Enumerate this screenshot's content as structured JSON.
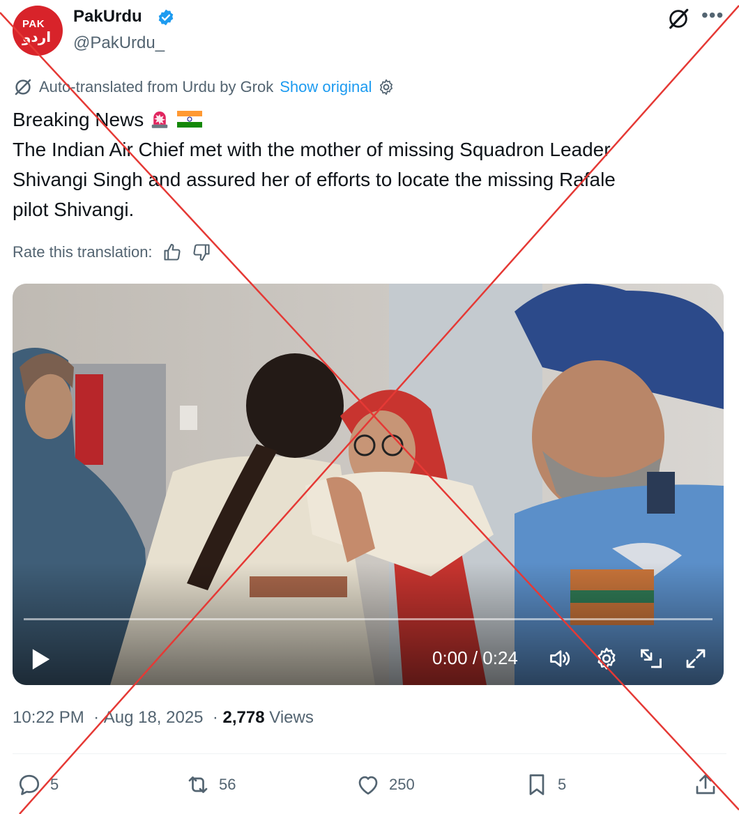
{
  "author": {
    "name": "PakUrdu",
    "handle": "@PakUrdu_",
    "avatar_text_top": "PAK",
    "avatar_text_bottom": "اردو",
    "avatar_color": "#d8232a",
    "verified": true,
    "verified_color": "#1d9bf0"
  },
  "icons": {
    "grok": "grok-icon",
    "more": "more-icon",
    "settings": "gear-icon",
    "thumbs_up": "thumbs-up-icon",
    "thumbs_down": "thumbs-down-icon"
  },
  "translation": {
    "label": "Auto-translated from Urdu by Grok",
    "show_original": "Show original"
  },
  "tweet": {
    "line1": "Breaking News",
    "line2": "The Indian Air Chief met with the mother of missing Squadron Leader",
    "line3": "Shivangi Singh and assured her of efforts to locate the missing Rafale",
    "line4": "pilot Shivangi.",
    "emojis": [
      "police-light",
      "india-flag"
    ]
  },
  "rate": {
    "label": "Rate this translation:"
  },
  "video": {
    "time": "0:00 / 0:24",
    "progress": 0.0
  },
  "meta": {
    "time": "10:22 PM",
    "date": "Aug 18, 2025",
    "views_count": "2,778",
    "views_label": "Views"
  },
  "actions": {
    "replies": "5",
    "reposts": "56",
    "likes": "250",
    "bookmarks": "5"
  },
  "overlay": {
    "cross_color": "#e53935"
  }
}
